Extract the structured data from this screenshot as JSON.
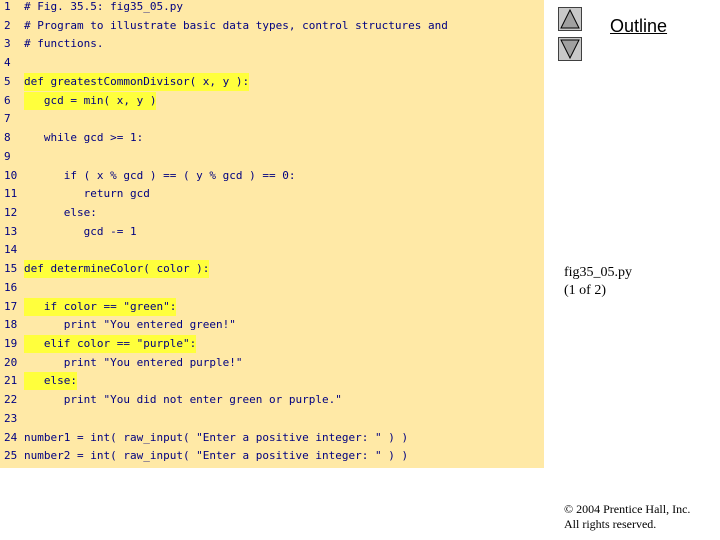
{
  "outline_label": "Outline",
  "nav": {
    "up_icon": "triangle-up-icon",
    "down_icon": "triangle-down-icon"
  },
  "caption": {
    "filename": "fig35_05.py",
    "page": "(1 of 2)"
  },
  "copyright": {
    "line1": "© 2004 Prentice Hall, Inc.",
    "line2": "All rights reserved."
  },
  "colors": {
    "code_bg": "#ffe9a6",
    "highlight": "#ffff3c",
    "code_text": "#000080"
  },
  "code": {
    "lines": [
      {
        "num": "1",
        "text": "# Fig. 35.5: fig35_05.py"
      },
      {
        "num": "2",
        "text": "# Program to illustrate basic data types, control structures and"
      },
      {
        "num": "3",
        "text": "# functions."
      },
      {
        "num": "4",
        "text": ""
      },
      {
        "num": "5",
        "text": "def greatestCommonDivisor( x, y ):"
      },
      {
        "num": "6",
        "text": "   gcd = min( x, y )"
      },
      {
        "num": "7",
        "text": ""
      },
      {
        "num": "8",
        "text": "   while gcd >= 1:"
      },
      {
        "num": "9",
        "text": ""
      },
      {
        "num": "10",
        "text": "      if ( x % gcd ) == ( y % gcd ) == 0:"
      },
      {
        "num": "11",
        "text": "         return gcd"
      },
      {
        "num": "12",
        "text": "      else:"
      },
      {
        "num": "13",
        "text": "         gcd -= 1"
      },
      {
        "num": "14",
        "text": ""
      },
      {
        "num": "15",
        "text": "def determineColor( color ):"
      },
      {
        "num": "16",
        "text": ""
      },
      {
        "num": "17",
        "text": "   if color == \"green\":"
      },
      {
        "num": "18",
        "text": "      print \"You entered green!\""
      },
      {
        "num": "19",
        "text": "   elif color == \"purple\":"
      },
      {
        "num": "20",
        "text": "      print \"You entered purple!\""
      },
      {
        "num": "21",
        "text": "   else:"
      },
      {
        "num": "22",
        "text": "      print \"You did not enter green or purple.\""
      },
      {
        "num": "23",
        "text": ""
      },
      {
        "num": "24",
        "text": "number1 = int( raw_input( \"Enter a positive integer: \" ) )"
      },
      {
        "num": "25",
        "text": "number2 = int( raw_input( \"Enter a positive integer: \" ) )"
      }
    ]
  }
}
